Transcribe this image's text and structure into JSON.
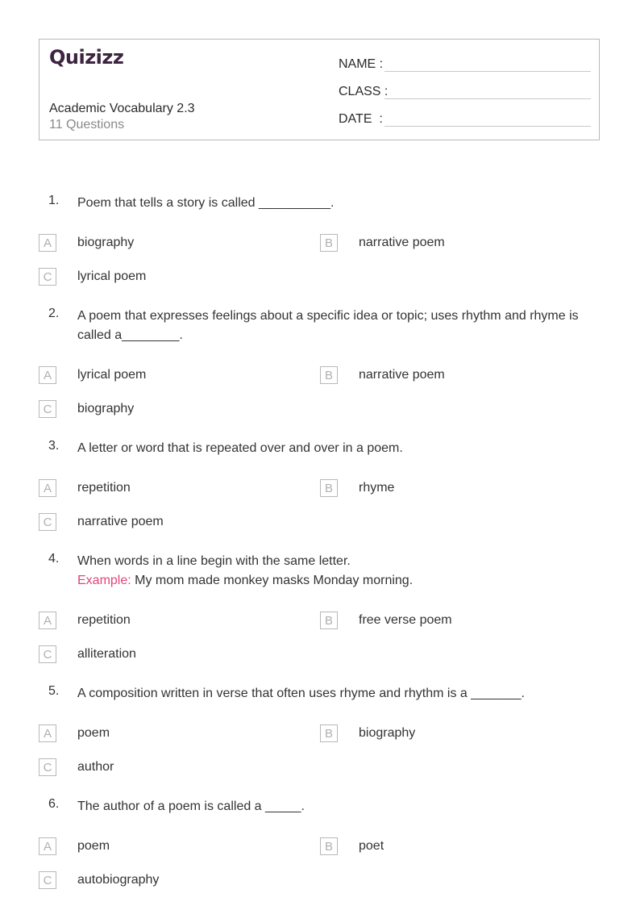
{
  "header": {
    "logo": "Quizizz",
    "title": "Academic Vocabulary 2.3",
    "subtitle": "11 Questions",
    "fields": [
      {
        "label": "NAME :"
      },
      {
        "label": "CLASS :"
      },
      {
        "label": "DATE  :"
      }
    ]
  },
  "questions": [
    {
      "number": "1.",
      "text": "Poem that tells a story is called __________.",
      "options": [
        {
          "letter": "A",
          "text": "biography"
        },
        {
          "letter": "B",
          "text": "narrative poem"
        },
        {
          "letter": "C",
          "text": "lyrical poem"
        }
      ]
    },
    {
      "number": "2.",
      "text": "A poem that expresses feelings about a specific idea or topic; uses rhythm and rhyme is called a________.",
      "options": [
        {
          "letter": "A",
          "text": "lyrical poem"
        },
        {
          "letter": "B",
          "text": "narrative poem"
        },
        {
          "letter": "C",
          "text": "biography"
        }
      ]
    },
    {
      "number": "3.",
      "text": "A letter or word that is repeated over and over in a poem.",
      "options": [
        {
          "letter": "A",
          "text": "repetition"
        },
        {
          "letter": "B",
          "text": "rhyme"
        },
        {
          "letter": "C",
          "text": "narrative poem"
        }
      ]
    },
    {
      "number": "4.",
      "text": "When words in a line begin with the same letter.",
      "example_label": "Example:",
      "example_text": " My mom made monkey masks Monday morning.",
      "options": [
        {
          "letter": "A",
          "text": "repetition"
        },
        {
          "letter": "B",
          "text": "free verse poem"
        },
        {
          "letter": "C",
          "text": "alliteration"
        }
      ]
    },
    {
      "number": "5.",
      "text": "A composition written in verse that often uses rhyme and rhythm is a _______.",
      "options": [
        {
          "letter": "A",
          "text": "poem"
        },
        {
          "letter": "B",
          "text": "biography"
        },
        {
          "letter": "C",
          "text": "author"
        }
      ]
    },
    {
      "number": "6.",
      "text": "The author of a poem is called a _____.",
      "options": [
        {
          "letter": "A",
          "text": "poem"
        },
        {
          "letter": "B",
          "text": "poet"
        },
        {
          "letter": "C",
          "text": "autobiography"
        }
      ]
    }
  ]
}
